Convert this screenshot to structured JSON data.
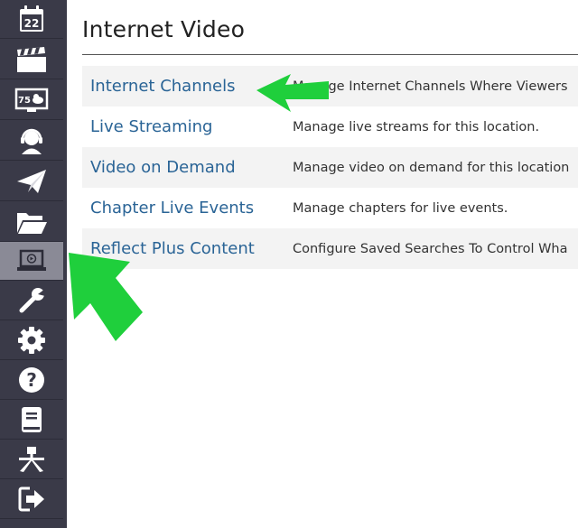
{
  "sidebar": {
    "items": [
      {
        "name": "calendar",
        "icon": "calendar-icon",
        "text": "22"
      },
      {
        "name": "clapperboard",
        "icon": "clapperboard-icon"
      },
      {
        "name": "weather-display",
        "icon": "weather-display-icon",
        "text": "75"
      },
      {
        "name": "support",
        "icon": "headset-icon"
      },
      {
        "name": "send",
        "icon": "paper-plane-icon"
      },
      {
        "name": "folder",
        "icon": "folder-open-icon"
      },
      {
        "name": "internet-video",
        "icon": "laptop-play-icon",
        "active": true
      },
      {
        "name": "tools",
        "icon": "wrench-icon"
      },
      {
        "name": "settings",
        "icon": "gear-icon"
      },
      {
        "name": "help",
        "icon": "question-circle-icon"
      },
      {
        "name": "docs",
        "icon": "book-icon"
      },
      {
        "name": "network",
        "icon": "network-icon"
      },
      {
        "name": "logout",
        "icon": "sign-out-icon"
      }
    ],
    "active_color": "#8a8a96",
    "background_color": "#3a3a48"
  },
  "main": {
    "title": "Internet Video",
    "rows": [
      {
        "label": "Internet Channels",
        "description": "Manage Internet Channels Where Viewers"
      },
      {
        "label": "Live Streaming",
        "description": "Manage live streams for this location."
      },
      {
        "label": "Video on Demand",
        "description": "Manage video on demand for this location"
      },
      {
        "label": "Chapter Live Events",
        "description": "Manage chapters for live events."
      },
      {
        "label": "Reflect Plus Content",
        "description": "Configure Saved Searches To Control Wha"
      }
    ],
    "link_color": "#2a6496"
  },
  "annotations": {
    "arrow_color": "#1fcf3c"
  }
}
